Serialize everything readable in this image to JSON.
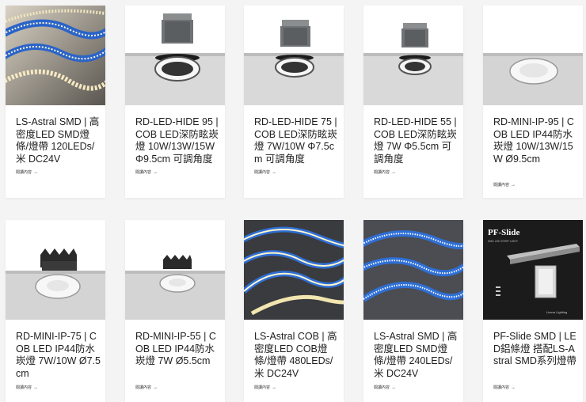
{
  "products": [
    {
      "title": "LS-Astral SMD | 高密度LED SMD燈條/燈帶 120LEDs/米 DC24V",
      "more": "閱讀內容",
      "image_icon": "led-strip-image"
    },
    {
      "title": "RD-LED-HIDE 95 | COB LED深防眩崁燈 10W/13W/15W Φ9.5cm 可調角度",
      "more": "閱讀內容",
      "image_icon": "downlight-image"
    },
    {
      "title": "RD-LED-HIDE 75 | COB LED深防眩崁燈 7W/10W Φ7.5cm 可調角度",
      "more": "閱讀內容",
      "image_icon": "downlight-image"
    },
    {
      "title": "RD-LED-HIDE 55 | COB LED深防眩崁燈 7W Φ5.5cm 可調角度",
      "more": "閱讀內容",
      "image_icon": "downlight-image"
    },
    {
      "title": "RD-MINI-IP-95 | COB LED IP44防水崁燈 10W/13W/15W Ø9.5cm",
      "more": "閱讀內容",
      "image_icon": "mini-downlight-image"
    },
    {
      "title": "RD-MINI-IP-75 | COB LED IP44防水崁燈 7W/10W Ø7.5cm",
      "more": "閱讀內容",
      "image_icon": "mini-downlight-image"
    },
    {
      "title": "RD-MINI-IP-55 | COB LED IP44防水崁燈 7W Ø5.5cm",
      "more": "閱讀內容",
      "image_icon": "mini-downlight-image"
    },
    {
      "title": "LS-Astral COB | 高密度LED COB燈條/燈帶 480LEDs/米 DC24V",
      "more": "閱讀內容",
      "image_icon": "cob-strip-image"
    },
    {
      "title": "LS-Astral SMD | 高密度LED SMD燈條/燈帶 240LEDs/米 DC24V",
      "more": "閱讀內容",
      "image_icon": "led-strip-image"
    },
    {
      "title": "PF-Slide SMD | LED鋁條燈 搭配LS-Astral SMD系列燈帶",
      "more": "閱讀內容",
      "image_icon": "profile-image",
      "image_text": {
        "brand": "PF-Slide",
        "sub": "SMD LED STRIP LIGHT",
        "tag": "Linear Lighting"
      }
    }
  ],
  "colors": {
    "background": "#f4f4f4",
    "card": "#ffffff",
    "text": "#1e1e1e"
  }
}
